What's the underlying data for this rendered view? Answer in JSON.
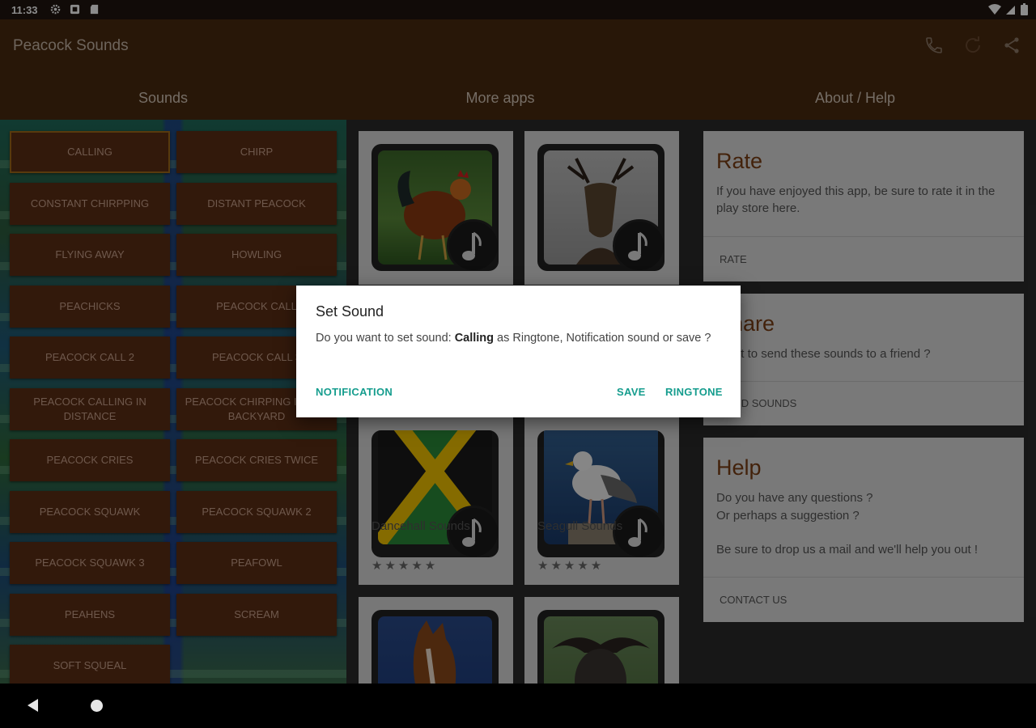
{
  "status_bar": {
    "time": "11:33"
  },
  "app_bar": {
    "title": "Peacock Sounds",
    "actions": [
      "phone-icon",
      "refresh-icon",
      "share-icon"
    ]
  },
  "tabs": [
    {
      "label": "Sounds"
    },
    {
      "label": "More apps"
    },
    {
      "label": "About / Help"
    }
  ],
  "sounds": [
    {
      "label": "CALLING"
    },
    {
      "label": "CHIRP"
    },
    {
      "label": "CONSTANT CHIRPPING"
    },
    {
      "label": "DISTANT PEACOCK"
    },
    {
      "label": "FLYING AWAY"
    },
    {
      "label": "HOWLING"
    },
    {
      "label": "PEACHICKS"
    },
    {
      "label": "PEACOCK CALL"
    },
    {
      "label": "PEACOCK CALL 2"
    },
    {
      "label": "PEACOCK CALL 3"
    },
    {
      "label": "PEACOCK CALLING IN DISTANCE"
    },
    {
      "label": "PEACOCK CHIRPING IN THE BACKYARD"
    },
    {
      "label": "PEACOCK CRIES"
    },
    {
      "label": "PEACOCK CRIES TWICE"
    },
    {
      "label": "PEACOCK SQUAWK"
    },
    {
      "label": "PEACOCK SQUAWK 2"
    },
    {
      "label": "PEACOCK SQUAWK 3"
    },
    {
      "label": "PEAFOWL"
    },
    {
      "label": "PEAHENS"
    },
    {
      "label": "SCREAM"
    },
    {
      "label": "SOFT SQUEAL"
    }
  ],
  "more_apps": [
    {
      "image": "rooster-image",
      "name": ""
    },
    {
      "image": "deer-image",
      "name": ""
    },
    {
      "image": "jamaica-flag-image",
      "name": "Dancehall Sounds",
      "stars": "★★★★★"
    },
    {
      "image": "seagull-image",
      "name": "Seagull Sounds",
      "stars": "★★★★★"
    },
    {
      "image": "horse-image",
      "name": ""
    },
    {
      "image": "buffalo-image",
      "name": ""
    }
  ],
  "about": {
    "rate": {
      "title": "Rate",
      "text": "If you have enjoyed this app, be sure to rate it in the play store here.",
      "action": "RATE"
    },
    "share": {
      "title": "Share",
      "text": "Want to send these sounds to a friend ?",
      "action": "SEND SOUNDS"
    },
    "help": {
      "title": "Help",
      "line1": "Do you have any questions ?",
      "line2": "Or perhaps a suggestion ?",
      "line3": "Be sure to drop us a mail and we'll help you out !",
      "action": "CONTACT US"
    }
  },
  "dialog": {
    "title": "Set Sound",
    "message_prefix": "Do you want to set sound: ",
    "message_bold": "Calling",
    "message_suffix": " as Ringtone, Notification sound or save ?",
    "buttons": {
      "notification": "NOTIFICATION",
      "save": "SAVE",
      "ringtone": "RINGTONE"
    }
  },
  "colors": {
    "app_bar": "#4a2a10",
    "accent": "#169d8e",
    "sound_button": "#5b2e14",
    "card_title": "#7a3e14"
  }
}
